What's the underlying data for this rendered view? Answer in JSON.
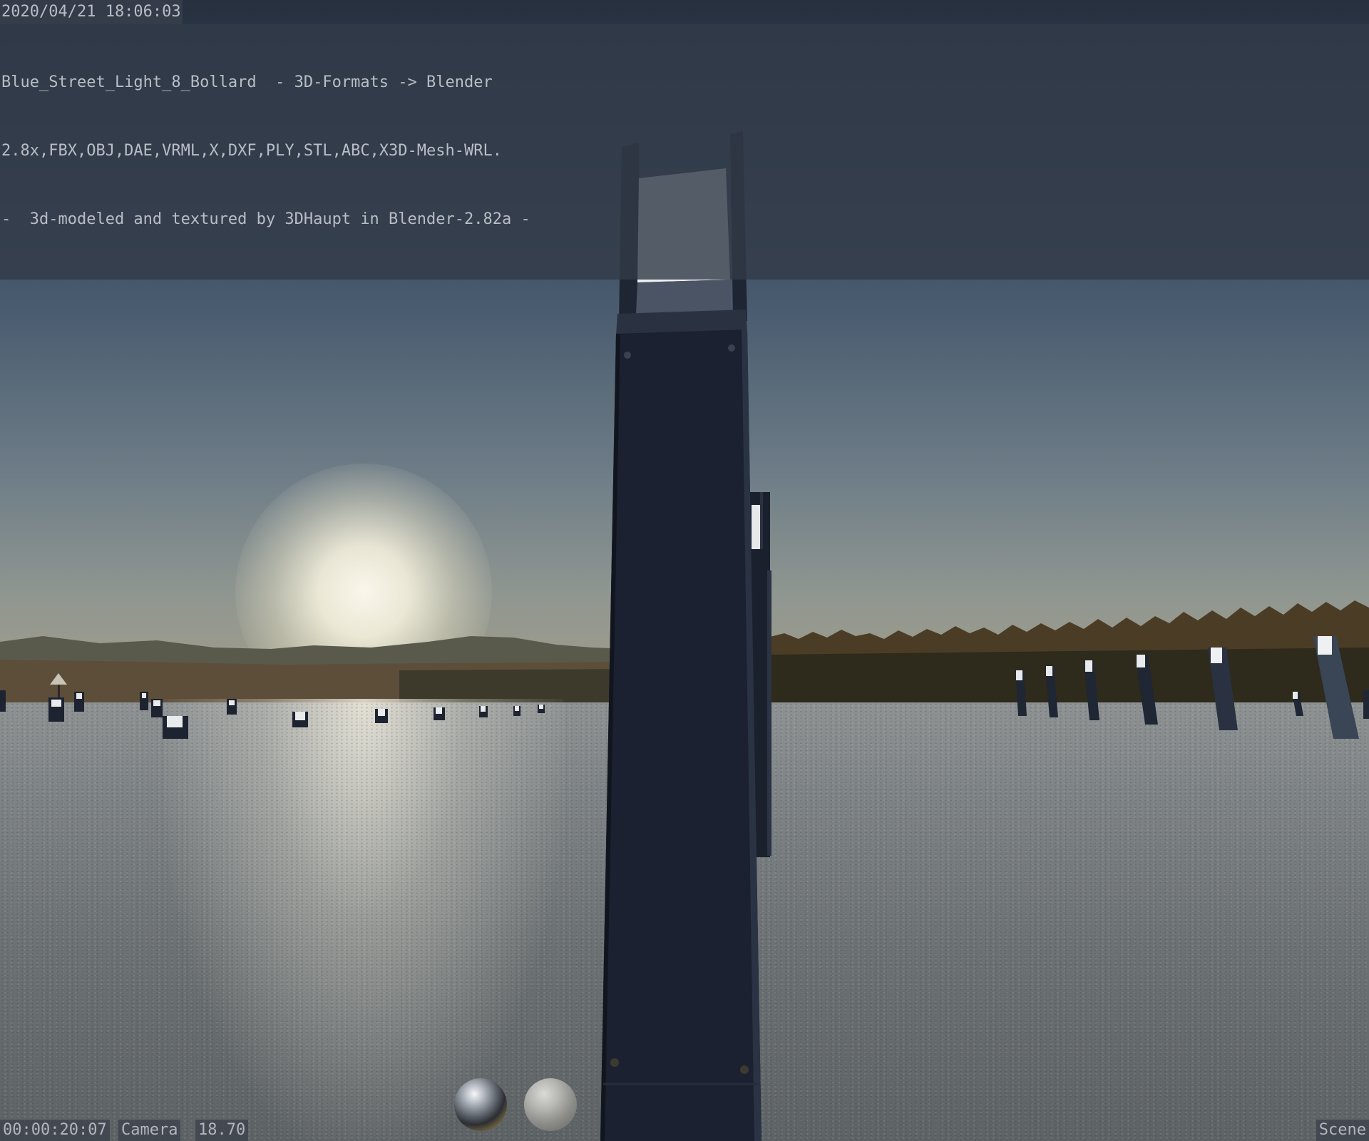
{
  "overlay": {
    "timestamp": "2020/04/21 18:06:03",
    "lines": [
      "Blue_Street_Light_8_Bollard  - 3D-Formats -> Blender",
      "2.8x,FBX,OBJ,DAE,VRML,X,DXF,PLY,STL,ABC,X3D-Mesh-WRL.",
      "-  3d-modeled and textured by 3DHaupt in Blender-2.82a -"
    ]
  },
  "footer": {
    "timecode": "00:00:20:07",
    "camera": "Camera",
    "lens": "18.70",
    "scene": "Scene"
  },
  "matcaps": [
    "chrome-sphere",
    "matte-sphere"
  ],
  "colors": {
    "sky_top": "#26303f",
    "sky_horizon": "#a59f8a",
    "ground": "#7f8486",
    "bollard": "#1b2130",
    "lamp": "#f2f4f5"
  }
}
